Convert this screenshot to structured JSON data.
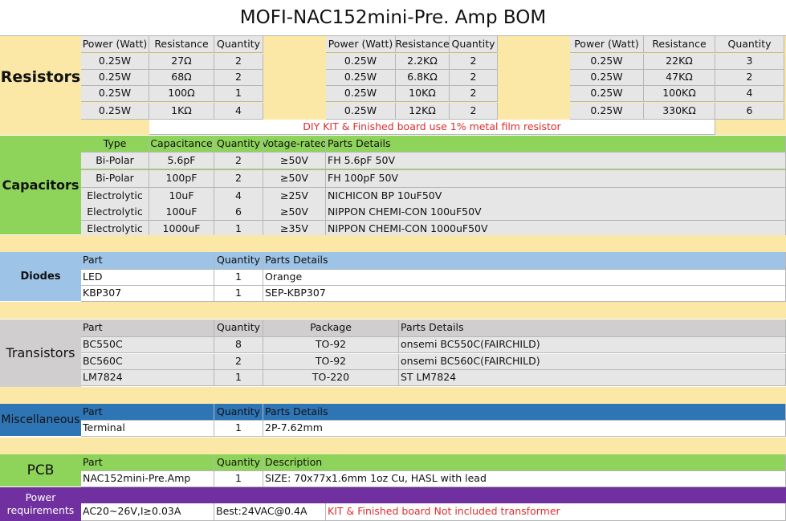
{
  "title": "MOFI-NAC152mini-Pre. Amp BOM",
  "colors": {
    "tan": "#fbe8a7",
    "lgray": "#e7e6e6",
    "mgray": "#d0cece",
    "green": "#8ed35a",
    "blue": "#9dc3e6",
    "blueDark": "#2e75b6",
    "purple": "#7030a0",
    "red": "#e02b2b"
  },
  "resistors": {
    "label": "Resistors",
    "headers": [
      "Power (Watt)",
      "Resistance",
      "Quantity"
    ],
    "groups": [
      [
        [
          "0.25W",
          "27Ω",
          "2"
        ],
        [
          "0.25W",
          "68Ω",
          "2"
        ],
        [
          "0.25W",
          "100Ω",
          "1"
        ],
        [
          "0.25W",
          "1KΩ",
          "4"
        ]
      ],
      [
        [
          "0.25W",
          "2.2KΩ",
          "2"
        ],
        [
          "0.25W",
          "6.8KΩ",
          "2"
        ],
        [
          "0.25W",
          "10KΩ",
          "2"
        ],
        [
          "0.25W",
          "12KΩ",
          "2"
        ]
      ],
      [
        [
          "0.25W",
          "22KΩ",
          "3"
        ],
        [
          "0.25W",
          "47KΩ",
          "2"
        ],
        [
          "0.25W",
          "100KΩ",
          "4"
        ],
        [
          "0.25W",
          "330KΩ",
          "6"
        ]
      ]
    ],
    "note": "DIY KIT & Finished board use 1% metal film resistor"
  },
  "capacitors": {
    "label": "Capacitors",
    "headers": [
      "Type",
      "Capacitance",
      "Quantity",
      "Votage-rated",
      "Parts Details"
    ],
    "rows": [
      [
        "Bi-Polar",
        "5.6pF",
        "2",
        "≥50V",
        "FH 5.6pF 50V"
      ],
      [
        "Bi-Polar",
        "100pF",
        "2",
        "≥50V",
        "FH 100pF 50V"
      ],
      [
        "Electrolytic",
        "10uF",
        "4",
        "≥25V",
        "NICHICON BP 10uF50V"
      ],
      [
        "Electrolytic",
        "100uF",
        "6",
        "≥50V",
        "NIPPON CHEMI-CON 100uF50V"
      ],
      [
        "Electrolytic",
        "1000uF",
        "1",
        "≥35V",
        "NIPPON CHEMI-CON 1000uF50V"
      ]
    ]
  },
  "diodes": {
    "label": "Diodes",
    "headers": [
      "Part",
      "Quantity",
      "Parts Details"
    ],
    "rows": [
      [
        "LED",
        "1",
        "Orange"
      ],
      [
        "KBP307",
        "1",
        "SEP-KBP307"
      ]
    ]
  },
  "transistors": {
    "label": "Transistors",
    "headers": [
      "Part",
      "Quantity",
      "Package",
      "Parts Details"
    ],
    "rows": [
      [
        "BC550C",
        "8",
        "TO-92",
        "onsemi BC550C(FAIRCHILD)"
      ],
      [
        "BC560C",
        "2",
        "TO-92",
        "onsemi BC560C(FAIRCHILD)"
      ],
      [
        "LM7824",
        "1",
        "TO-220",
        "ST LM7824"
      ]
    ]
  },
  "misc": {
    "label": "Miscellaneous",
    "headers": [
      "Part",
      "Quantity",
      "Parts Details"
    ],
    "rows": [
      [
        "Terminal",
        "1",
        "2P-7.62mm"
      ]
    ]
  },
  "pcb": {
    "label": "PCB",
    "headers": [
      "Part",
      "Quantity",
      "Description"
    ],
    "rows": [
      [
        "NAC152mini-Pre.Amp",
        "1",
        "SIZE:  70x77x1.6mm  1oz Cu, HASL with lead"
      ]
    ]
  },
  "power": {
    "label": "Power requirements",
    "input": "AC20~26V,I≥0.03A",
    "best": "Best:24VAC@0.4A",
    "note": "KIT & Finished board Not included transformer"
  }
}
